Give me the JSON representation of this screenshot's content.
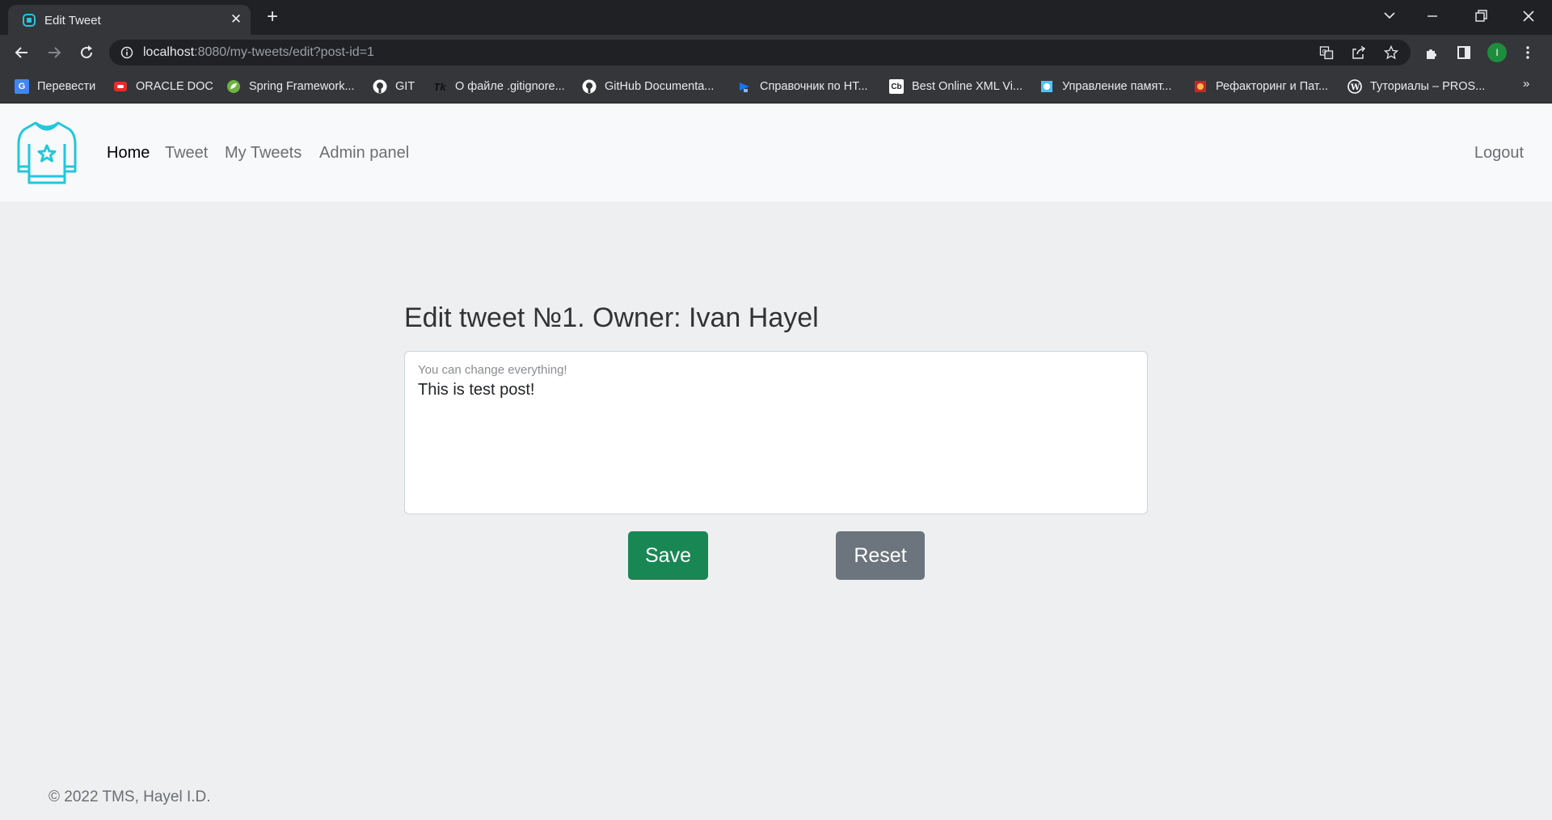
{
  "browser": {
    "tab_title": "Edit Tweet",
    "tab_close": "✕",
    "new_tab": "+",
    "url_host": "localhost",
    "url_rest": ":8080/my-tweets/edit?post-id=1",
    "profile_initial": "I",
    "bookmarks_more": "»",
    "bookmarks": [
      {
        "label": "Перевести",
        "icon": "translate-icon",
        "color": "#4285f4"
      },
      {
        "label": "ORACLE DOC",
        "icon": "oracle-icon",
        "color": "#e52d27"
      },
      {
        "label": "Spring Framework...",
        "icon": "spring-icon",
        "color": "#6db33f"
      },
      {
        "label": "GIT",
        "icon": "github-icon",
        "color": "#ffffff"
      },
      {
        "label": "О файле .gitignore...",
        "icon": "tk-icon",
        "color": "#000000"
      },
      {
        "label": "GitHub Documenta...",
        "icon": "github-icon",
        "color": "#ffffff"
      },
      {
        "label": "Справочник по НТ...",
        "icon": "reference-icon",
        "color": "#1a73e8"
      },
      {
        "label": "Best Online XML Vi...",
        "icon": "cb-icon",
        "color": "#ffffff"
      },
      {
        "label": "Управление памят...",
        "icon": "memory-icon",
        "color": "#4fc3f7"
      },
      {
        "label": "Рефакторинг и Пат...",
        "icon": "refactoring-icon",
        "color": "#c62828"
      },
      {
        "label": "Туториалы – PROS...",
        "icon": "wordpress-icon",
        "color": "#ffffff"
      }
    ]
  },
  "navbar": {
    "links": [
      {
        "label": "Home",
        "active": true
      },
      {
        "label": "Tweet",
        "active": false
      },
      {
        "label": "My Tweets",
        "active": false
      },
      {
        "label": "Admin panel",
        "active": false
      }
    ],
    "logout": "Logout"
  },
  "main": {
    "title": "Edit tweet №1. Owner: Ivan Hayel",
    "editor_label": "You can change everything!",
    "editor_value": "This is test post!",
    "save_label": "Save",
    "reset_label": "Reset"
  },
  "footer": {
    "text": "© 2022 TMS, Hayel I.D."
  },
  "colors": {
    "accent": "#22c7dd",
    "save": "#198754",
    "reset": "#6c757d"
  }
}
